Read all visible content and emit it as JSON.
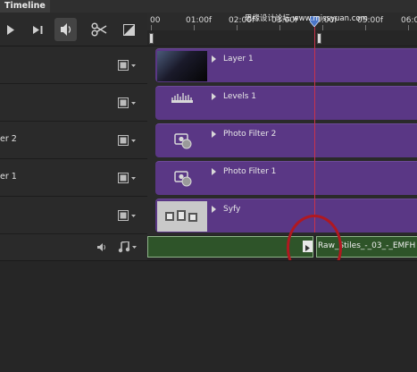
{
  "panel": {
    "tab_label": "Timeline"
  },
  "ruler": {
    "labels": [
      "00",
      "01:00f",
      "02:00f",
      "03:00f",
      "4:00f",
      "05:00f",
      "06:0"
    ]
  },
  "watermark": "思缘设计论坛 www.missyuan.com",
  "tracks": [
    {
      "header_label": "",
      "clip_label": "Layer 1",
      "thumbnail": "dark-gradient"
    },
    {
      "header_label": "",
      "clip_label": "Levels 1",
      "thumbnail": "levels-icon"
    },
    {
      "header_label": "er 2",
      "clip_label": "Photo Filter 2",
      "thumbnail": "photo-filter-icon"
    },
    {
      "header_label": "er 1",
      "clip_label": "Photo Filter 1",
      "thumbnail": "photo-filter-icon"
    },
    {
      "header_label": "",
      "clip_label": "Syfy",
      "thumbnail": "syfy-logo"
    }
  ],
  "audio": {
    "clip2_label": "Raw_Stiles_-_03_-_EMFH"
  },
  "icons": {
    "play": "play-icon",
    "step": "step-forward-icon",
    "volume": "volume-icon",
    "split": "scissors-icon",
    "transition": "transition-icon",
    "film": "film-strip-icon",
    "music": "music-note-icon",
    "speaker": "speaker-icon"
  },
  "colors": {
    "clip_purple": "#5a3785",
    "audio_green": "#2e5429",
    "playhead": "#c8324a",
    "annotation": "#b01820"
  }
}
